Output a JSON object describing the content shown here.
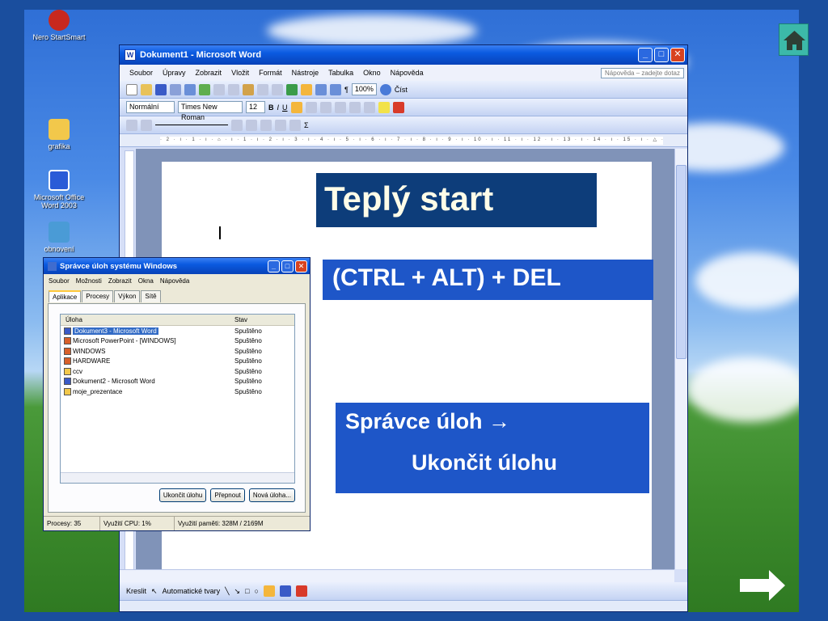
{
  "desktop": {
    "icons": [
      {
        "label": "Nero StartSmart"
      },
      {
        "label": "grafika"
      },
      {
        "label": "Microsoft Office Word 2003"
      },
      {
        "label": "obnovení"
      }
    ]
  },
  "word": {
    "title": "Dokument1 - Microsoft Word",
    "menu": [
      "Soubor",
      "Úpravy",
      "Zobrazit",
      "Vložit",
      "Formát",
      "Nástroje",
      "Tabulka",
      "Okno",
      "Nápověda"
    ],
    "help_placeholder": "Nápověda – zadejte dotaz",
    "style": "Normální",
    "font": "Times New Roman",
    "size": "12",
    "zoom": "100%",
    "read_label": "Číst",
    "ruler_text": "· 2 · ı · 1 · ı · ⌂ · ı · 1 · ı · 2 · ı · 3 · ı · 4 · ı · 5 · ı · 6 · ı · 7 · ı · 8 · ı · 9 · ı · 10 · ı · 11 · ı · 12 · ı · 13 · ı · 14 · ı · 15 · ı · △ · ı · 17 · ı · 18 ·",
    "draw_label": "Kreslit",
    "autoshapes_label": "Automatické tvary"
  },
  "taskmgr": {
    "title": "Správce úloh systému Windows",
    "menu": [
      "Soubor",
      "Možnosti",
      "Zobrazit",
      "Okna",
      "Nápověda"
    ],
    "tabs": [
      "Aplikace",
      "Procesy",
      "Výkon",
      "Sítě"
    ],
    "columns": [
      "Úloha",
      "Stav"
    ],
    "rows": [
      {
        "task": "Dokument3 - Microsoft Word",
        "status": "Spuštěno"
      },
      {
        "task": "Microsoft PowerPoint - [WINDOWS]",
        "status": "Spuštěno"
      },
      {
        "task": "WINDOWS",
        "status": "Spuštěno"
      },
      {
        "task": "HARDWARE",
        "status": "Spuštěno"
      },
      {
        "task": "ccv",
        "status": "Spuštěno"
      },
      {
        "task": "Dokument2 - Microsoft Word",
        "status": "Spuštěno"
      },
      {
        "task": "moje_prezentace",
        "status": "Spuštěno"
      }
    ],
    "buttons": [
      "Ukončit úlohu",
      "Přepnout",
      "Nová úloha..."
    ],
    "status": {
      "processes": "Procesy: 35",
      "cpu": "Využití CPU: 1%",
      "memory": "Využití paměti: 328M / 2169M"
    }
  },
  "slide": {
    "title": "Teplý start",
    "keys": "(CTRL + ALT) + DEL",
    "task_line1": "Správce úloh  →",
    "task_line2": "Ukončit úlohu"
  },
  "colors": {
    "slide_box": "#1e56c8",
    "title_box": "#0d3d7a",
    "home_button": "#3cb9a9"
  },
  "icons": [
    "home-icon",
    "next-arrow-icon",
    "word-app-icon",
    "folder-icon"
  ]
}
